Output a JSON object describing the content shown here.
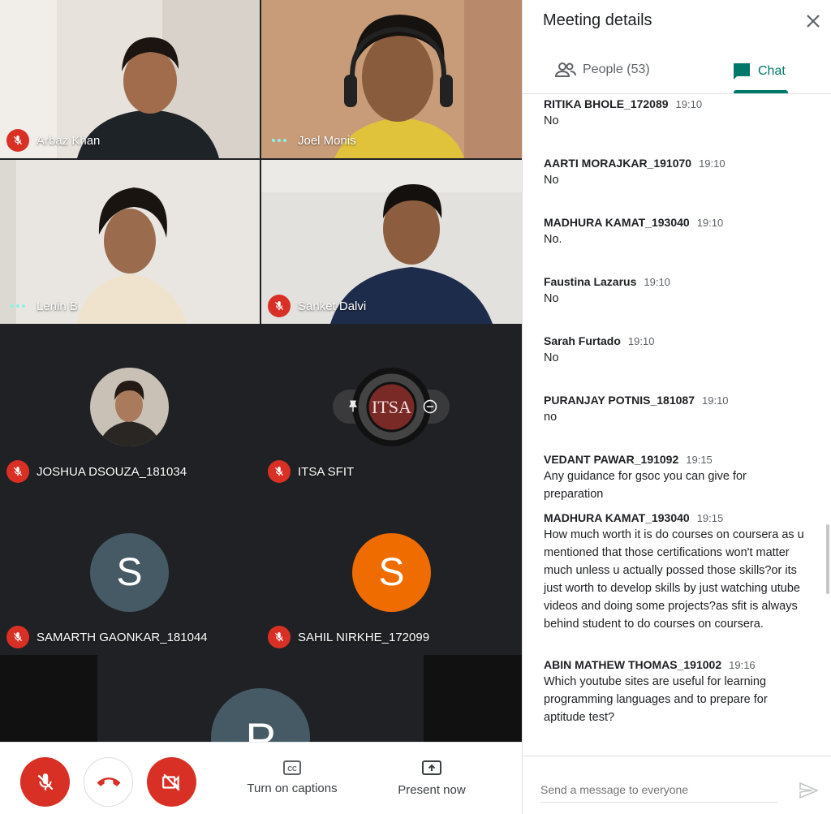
{
  "participants": [
    {
      "name": "Arbaz Khan",
      "status": "muted"
    },
    {
      "name": "Joel Monis",
      "status": "speaking"
    },
    {
      "name": "Lenin B",
      "status": "speaking"
    },
    {
      "name": "Sanket Dalvi",
      "status": "muted"
    },
    {
      "name": "JOSHUA DSOUZA_181034",
      "status": "muted"
    },
    {
      "name": "ITSA SFIT",
      "status": "muted",
      "logo_text": "ITSA"
    },
    {
      "name": "SAMARTH GAONKAR_181044",
      "status": "muted",
      "initial": "S"
    },
    {
      "name": "SAHIL NIRKHE_172099",
      "status": "muted",
      "initial": "S"
    },
    {
      "initial": "P"
    }
  ],
  "controls": {
    "captions_label": "Turn on captions",
    "present_label": "Present now"
  },
  "panel": {
    "title": "Meeting details",
    "people_tab": "People (53)",
    "chat_tab": "Chat",
    "compose_placeholder": "Send a message to everyone"
  },
  "messages": [
    {
      "sender": "RITIKA BHOLE_172089",
      "time": "19:10",
      "text": "No"
    },
    {
      "sender": "AARTI MORAJKAR_191070",
      "time": "19:10",
      "text": "No"
    },
    {
      "sender": "MADHURA KAMAT_193040",
      "time": "19:10",
      "text": "No."
    },
    {
      "sender": "Faustina Lazarus",
      "time": "19:10",
      "text": "No"
    },
    {
      "sender": "Sarah Furtado",
      "time": "19:10",
      "text": "No"
    },
    {
      "sender": "PURANJAY POTNIS_181087",
      "time": "19:10",
      "text": "no"
    },
    {
      "sender": "VEDANT PAWAR_191092",
      "time": "19:15",
      "text": "Any guidance for gsoc you can give for preparation"
    },
    {
      "sender": "MADHURA KAMAT_193040",
      "time": "19:15",
      "text": "How much worth it is do courses on coursera as u mentioned that those certifications won't matter much unless u actually possed those skills?or its just worth to develop skills by just watching utube videos and doing some projects?as sfit is always behind student to do courses on coursera."
    },
    {
      "sender": "ABIN MATHEW THOMAS_191002",
      "time": "19:16",
      "text": "Which youtube sites are useful for learning programming languages and to prepare for aptitude test?"
    }
  ],
  "colors": {
    "accent": "#00796b",
    "danger": "#d93025",
    "grid_bg": "#202124",
    "avatar_slate": "#455a64",
    "avatar_orange": "#ef6c00"
  }
}
